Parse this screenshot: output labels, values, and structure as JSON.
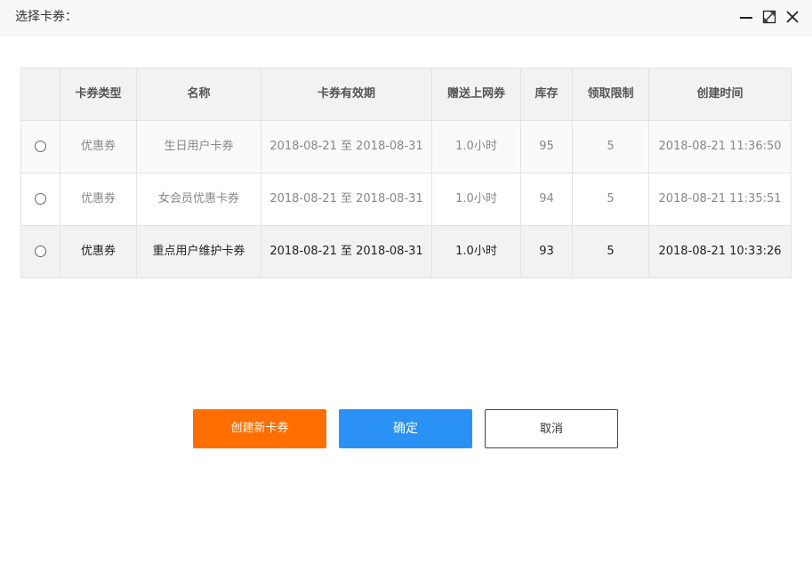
{
  "dialog": {
    "title": "选择卡券："
  },
  "window_controls": [
    "minimize-icon",
    "maximize-icon",
    "close-icon"
  ],
  "table": {
    "headers": [
      "",
      "卡券类型",
      "名称",
      "卡券有效期",
      "赠送上网券",
      "库存",
      "领取限制",
      "创建时间"
    ],
    "rows": [
      {
        "type": "优惠券",
        "name": "生日用户卡券",
        "validity": "2018-08-21 至 2018-08-31",
        "gift": "1.0小时",
        "stock": "95",
        "limit": "5",
        "created": "2018-08-21 11:36:50"
      },
      {
        "type": "优惠券",
        "name": "女会员优惠卡券",
        "validity": "2018-08-21 至 2018-08-31",
        "gift": "1.0小时",
        "stock": "94",
        "limit": "5",
        "created": "2018-08-21 11:35:51"
      },
      {
        "type": "优惠券",
        "name": "重点用户维护卡券",
        "validity": "2018-08-21 至 2018-08-31",
        "gift": "1.0小时",
        "stock": "93",
        "limit": "5",
        "created": "2018-08-21 10:33:26"
      }
    ]
  },
  "buttons": {
    "create": "创建新卡券",
    "ok": "确定",
    "cancel": "取消"
  },
  "colors": {
    "create_button": "#ff6e00",
    "ok_button": "#2b92f5",
    "header_bg": "#f2f2f2",
    "titlebar_bg": "#f8f8f8"
  }
}
